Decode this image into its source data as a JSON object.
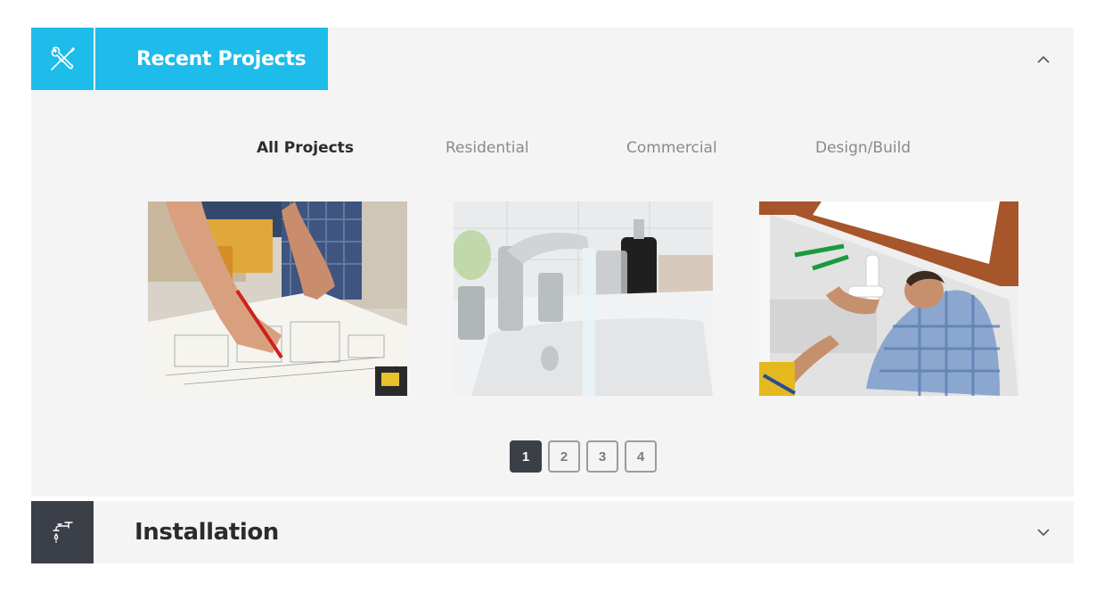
{
  "panels": {
    "recent": {
      "title": "Recent Projects",
      "icon": "tools-icon",
      "state": "expanded",
      "accent_color": "#1ebcea"
    },
    "installation": {
      "title": "Installation",
      "icon": "faucet-icon",
      "state": "collapsed",
      "icon_bg_color": "#3b3f48"
    }
  },
  "filters": [
    {
      "label": "All Projects",
      "active": true
    },
    {
      "label": "Residential",
      "active": false
    },
    {
      "label": "Commercial",
      "active": false
    },
    {
      "label": "Design/Build",
      "active": false
    }
  ],
  "gallery": {
    "items": [
      {
        "subject": "blueprint-drafting"
      },
      {
        "subject": "faucet-sink"
      },
      {
        "subject": "plumber-under-sink"
      }
    ]
  },
  "pagination": {
    "pages": [
      "1",
      "2",
      "3",
      "4"
    ],
    "current": "1"
  }
}
